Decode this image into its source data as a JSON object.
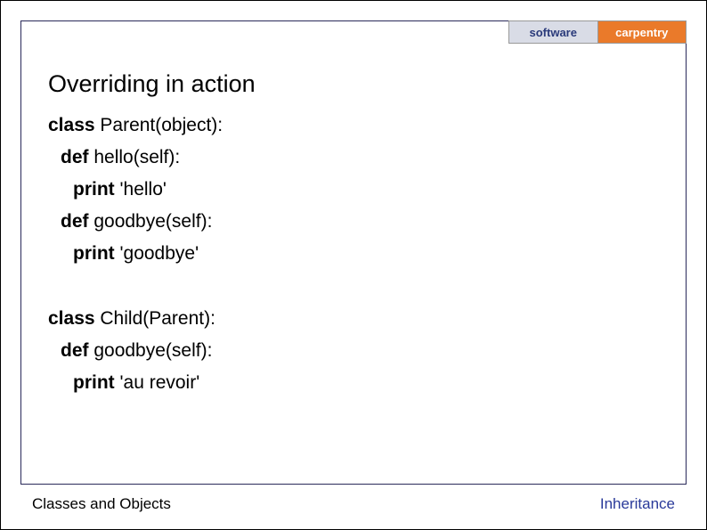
{
  "logo": {
    "left": "software",
    "right": "carpentry"
  },
  "title": "Overriding in action",
  "code": {
    "block1": {
      "l1_kw": "class ",
      "l1_rest": "Parent(object):",
      "l2_kw": "def ",
      "l2_rest": "hello(self):",
      "l3_kw": "print ",
      "l3_rest": "'hello'",
      "l4_kw": "def ",
      "l4_rest": "goodbye(self):",
      "l5_kw": "print ",
      "l5_rest": "'goodbye'"
    },
    "block2": {
      "l1_kw": "class ",
      "l1_rest": "Child(Parent):",
      "l2_kw": "def ",
      "l2_rest": "goodbye(self):",
      "l3_kw": "print ",
      "l3_rest": "'au revoir'"
    }
  },
  "footer": {
    "left": "Classes and Objects",
    "right": "Inheritance"
  }
}
